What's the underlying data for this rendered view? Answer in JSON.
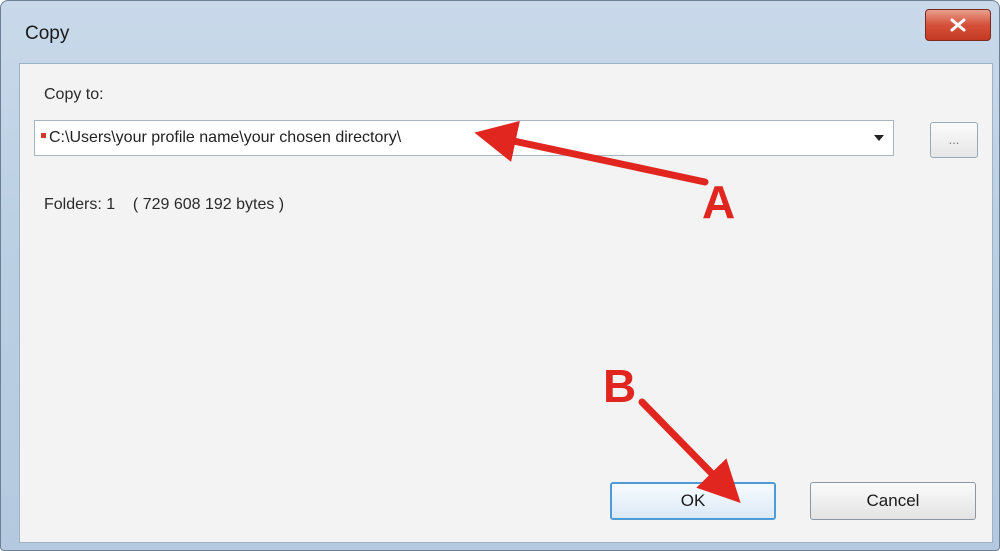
{
  "window": {
    "title": "Copy"
  },
  "copy_to": {
    "label": "Copy to:",
    "path_value": "C:\\Users\\your profile name\\your chosen directory\\",
    "browse_label": "..."
  },
  "info": {
    "folders_text": "Folders: 1    ( 729 608 192 bytes )"
  },
  "buttons": {
    "ok_label": "OK",
    "cancel_label": "Cancel"
  },
  "annotations": {
    "a_label": "A",
    "b_label": "B",
    "arrow_color": "#e0261f"
  },
  "icons": {
    "close": "close-icon",
    "dropdown": "chevron-down-icon"
  }
}
